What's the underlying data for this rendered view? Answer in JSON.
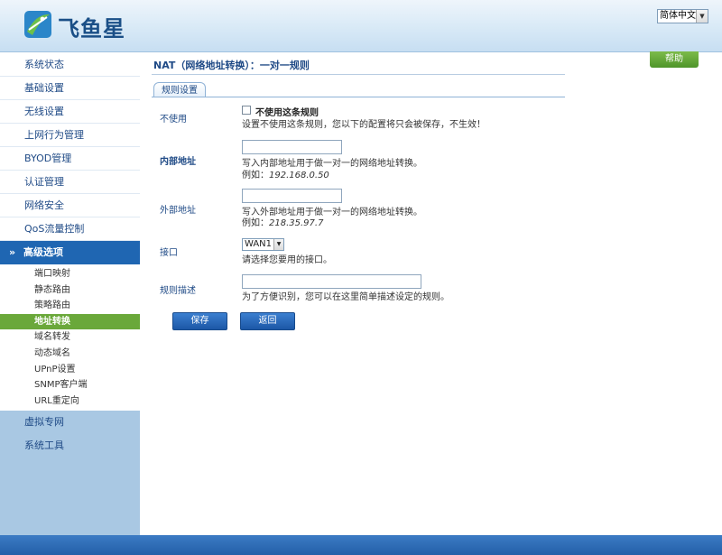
{
  "header": {
    "brand": "飞鱼星",
    "language": "简体中文"
  },
  "sidebar": {
    "items_top": [
      {
        "label": "系统状态"
      },
      {
        "label": "基础设置"
      },
      {
        "label": "无线设置"
      },
      {
        "label": "上网行为管理"
      },
      {
        "label": "BYOD管理"
      },
      {
        "label": "认证管理"
      },
      {
        "label": "网络安全"
      },
      {
        "label": "QoS流量控制"
      }
    ],
    "active": {
      "label": "高级选项"
    },
    "sub_items": [
      {
        "label": "端口映射"
      },
      {
        "label": "静态路由"
      },
      {
        "label": "策略路由"
      },
      {
        "label": "地址转换"
      },
      {
        "label": "域名转发"
      },
      {
        "label": "动态域名"
      },
      {
        "label": "UPnP设置"
      },
      {
        "label": "SNMP客户端"
      },
      {
        "label": "URL重定向"
      }
    ],
    "items_bottom": [
      {
        "label": "虚拟专网"
      },
      {
        "label": "系统工具"
      }
    ]
  },
  "main": {
    "help_label": "帮助",
    "title": "NAT（网络地址转换）：一对一规则",
    "tab_label": "规则设置",
    "disable": {
      "label": "不使用",
      "checkbox_label": "不使用这条规则",
      "hint": "设置不使用这条规则，您以下的配置将只会被保存，不生效！",
      "checked": false
    },
    "internal": {
      "label": "内部地址",
      "value": "",
      "hint": "写入内部地址用于做一对一的网络地址转换。",
      "example_prefix": "例如：",
      "example_value": "192.168.0.50"
    },
    "external": {
      "label": "外部地址",
      "value": "",
      "hint": "写入外部地址用于做一对一的网络地址转换。",
      "example_prefix": "例如：",
      "example_value": "218.35.97.7"
    },
    "interface": {
      "label": "接口",
      "selected": "WAN1",
      "hint": "请选择您要用的接口。"
    },
    "description": {
      "label": "规则描述",
      "value": "",
      "hint": "为了方便识别，您可以在这里简单描述设定的规则。"
    },
    "save_label": "保存",
    "back_label": "返回"
  }
}
